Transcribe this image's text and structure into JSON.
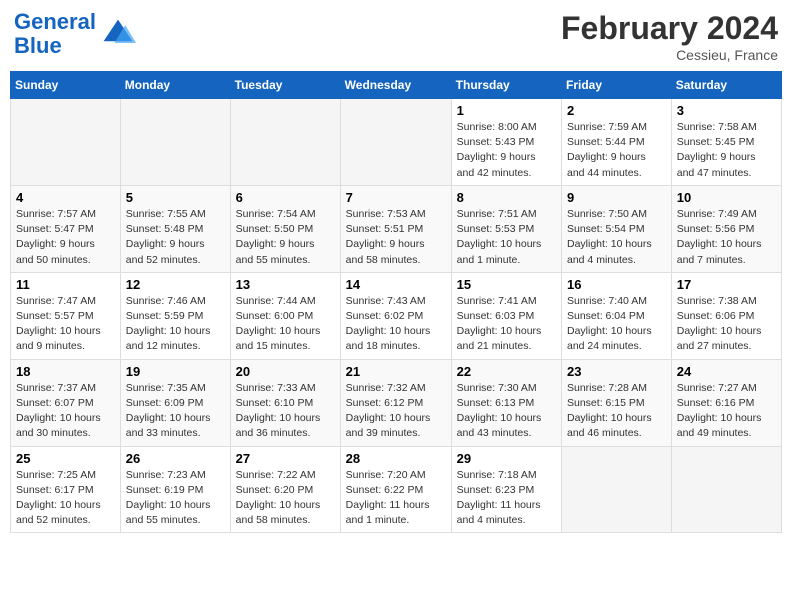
{
  "header": {
    "logo_line1": "General",
    "logo_line2": "Blue",
    "month_year": "February 2024",
    "location": "Cessieu, France"
  },
  "weekdays": [
    "Sunday",
    "Monday",
    "Tuesday",
    "Wednesday",
    "Thursday",
    "Friday",
    "Saturday"
  ],
  "weeks": [
    [
      {
        "num": "",
        "info": ""
      },
      {
        "num": "",
        "info": ""
      },
      {
        "num": "",
        "info": ""
      },
      {
        "num": "",
        "info": ""
      },
      {
        "num": "1",
        "info": "Sunrise: 8:00 AM\nSunset: 5:43 PM\nDaylight: 9 hours\nand 42 minutes."
      },
      {
        "num": "2",
        "info": "Sunrise: 7:59 AM\nSunset: 5:44 PM\nDaylight: 9 hours\nand 44 minutes."
      },
      {
        "num": "3",
        "info": "Sunrise: 7:58 AM\nSunset: 5:45 PM\nDaylight: 9 hours\nand 47 minutes."
      }
    ],
    [
      {
        "num": "4",
        "info": "Sunrise: 7:57 AM\nSunset: 5:47 PM\nDaylight: 9 hours\nand 50 minutes."
      },
      {
        "num": "5",
        "info": "Sunrise: 7:55 AM\nSunset: 5:48 PM\nDaylight: 9 hours\nand 52 minutes."
      },
      {
        "num": "6",
        "info": "Sunrise: 7:54 AM\nSunset: 5:50 PM\nDaylight: 9 hours\nand 55 minutes."
      },
      {
        "num": "7",
        "info": "Sunrise: 7:53 AM\nSunset: 5:51 PM\nDaylight: 9 hours\nand 58 minutes."
      },
      {
        "num": "8",
        "info": "Sunrise: 7:51 AM\nSunset: 5:53 PM\nDaylight: 10 hours\nand 1 minute."
      },
      {
        "num": "9",
        "info": "Sunrise: 7:50 AM\nSunset: 5:54 PM\nDaylight: 10 hours\nand 4 minutes."
      },
      {
        "num": "10",
        "info": "Sunrise: 7:49 AM\nSunset: 5:56 PM\nDaylight: 10 hours\nand 7 minutes."
      }
    ],
    [
      {
        "num": "11",
        "info": "Sunrise: 7:47 AM\nSunset: 5:57 PM\nDaylight: 10 hours\nand 9 minutes."
      },
      {
        "num": "12",
        "info": "Sunrise: 7:46 AM\nSunset: 5:59 PM\nDaylight: 10 hours\nand 12 minutes."
      },
      {
        "num": "13",
        "info": "Sunrise: 7:44 AM\nSunset: 6:00 PM\nDaylight: 10 hours\nand 15 minutes."
      },
      {
        "num": "14",
        "info": "Sunrise: 7:43 AM\nSunset: 6:02 PM\nDaylight: 10 hours\nand 18 minutes."
      },
      {
        "num": "15",
        "info": "Sunrise: 7:41 AM\nSunset: 6:03 PM\nDaylight: 10 hours\nand 21 minutes."
      },
      {
        "num": "16",
        "info": "Sunrise: 7:40 AM\nSunset: 6:04 PM\nDaylight: 10 hours\nand 24 minutes."
      },
      {
        "num": "17",
        "info": "Sunrise: 7:38 AM\nSunset: 6:06 PM\nDaylight: 10 hours\nand 27 minutes."
      }
    ],
    [
      {
        "num": "18",
        "info": "Sunrise: 7:37 AM\nSunset: 6:07 PM\nDaylight: 10 hours\nand 30 minutes."
      },
      {
        "num": "19",
        "info": "Sunrise: 7:35 AM\nSunset: 6:09 PM\nDaylight: 10 hours\nand 33 minutes."
      },
      {
        "num": "20",
        "info": "Sunrise: 7:33 AM\nSunset: 6:10 PM\nDaylight: 10 hours\nand 36 minutes."
      },
      {
        "num": "21",
        "info": "Sunrise: 7:32 AM\nSunset: 6:12 PM\nDaylight: 10 hours\nand 39 minutes."
      },
      {
        "num": "22",
        "info": "Sunrise: 7:30 AM\nSunset: 6:13 PM\nDaylight: 10 hours\nand 43 minutes."
      },
      {
        "num": "23",
        "info": "Sunrise: 7:28 AM\nSunset: 6:15 PM\nDaylight: 10 hours\nand 46 minutes."
      },
      {
        "num": "24",
        "info": "Sunrise: 7:27 AM\nSunset: 6:16 PM\nDaylight: 10 hours\nand 49 minutes."
      }
    ],
    [
      {
        "num": "25",
        "info": "Sunrise: 7:25 AM\nSunset: 6:17 PM\nDaylight: 10 hours\nand 52 minutes."
      },
      {
        "num": "26",
        "info": "Sunrise: 7:23 AM\nSunset: 6:19 PM\nDaylight: 10 hours\nand 55 minutes."
      },
      {
        "num": "27",
        "info": "Sunrise: 7:22 AM\nSunset: 6:20 PM\nDaylight: 10 hours\nand 58 minutes."
      },
      {
        "num": "28",
        "info": "Sunrise: 7:20 AM\nSunset: 6:22 PM\nDaylight: 11 hours\nand 1 minute."
      },
      {
        "num": "29",
        "info": "Sunrise: 7:18 AM\nSunset: 6:23 PM\nDaylight: 11 hours\nand 4 minutes."
      },
      {
        "num": "",
        "info": ""
      },
      {
        "num": "",
        "info": ""
      }
    ]
  ]
}
